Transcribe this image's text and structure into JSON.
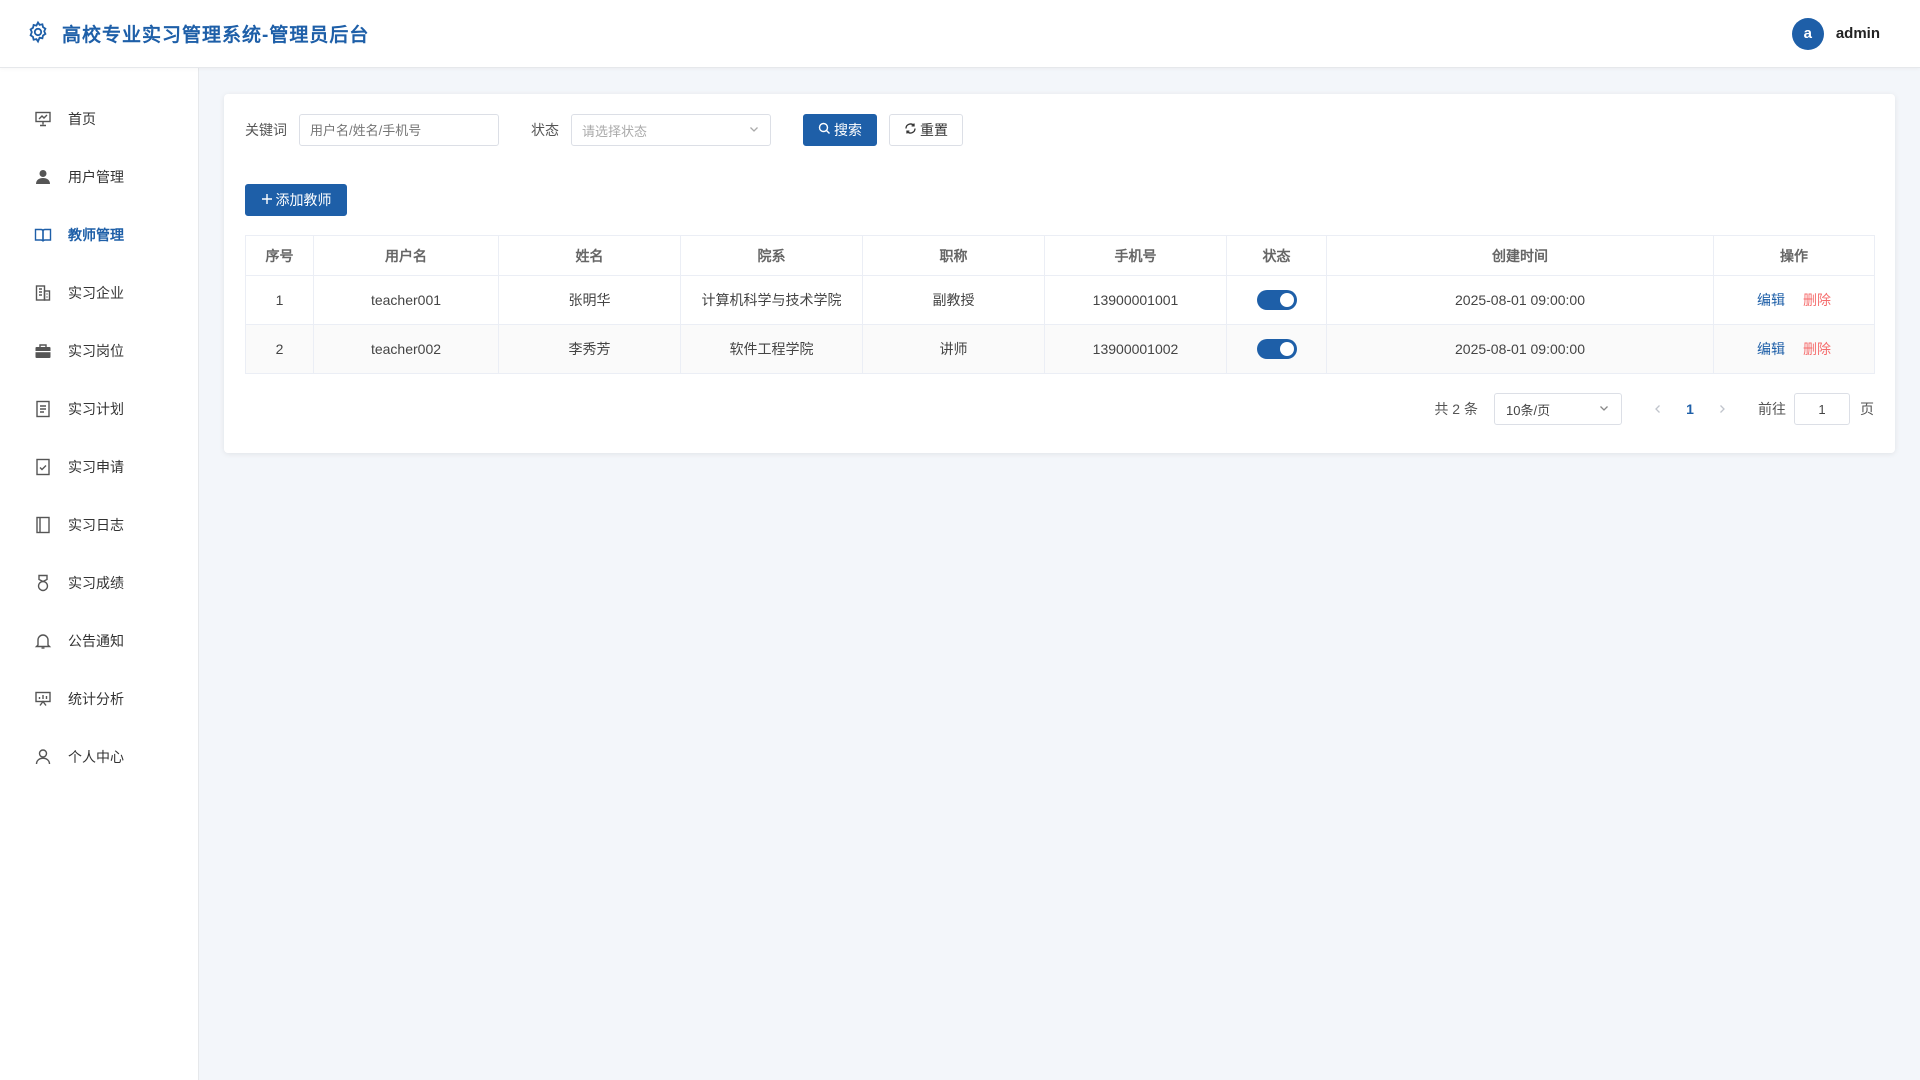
{
  "app": {
    "title": "高校专业实习管理系统-管理员后台",
    "brand_color": "#1e5fa8",
    "icon": "gear-icon"
  },
  "user": {
    "avatar_letter": "a",
    "name": "admin"
  },
  "sidebar": {
    "items": [
      {
        "label": "首页",
        "icon": "presentation-board-icon"
      },
      {
        "label": "用户管理",
        "icon": "user-filled-icon"
      },
      {
        "label": "教师管理",
        "icon": "open-book-icon",
        "active": true
      },
      {
        "label": "实习企业",
        "icon": "building-icon"
      },
      {
        "label": "实习岗位",
        "icon": "briefcase-icon"
      },
      {
        "label": "实习计划",
        "icon": "document-icon"
      },
      {
        "label": "实习申请",
        "icon": "checked-document-icon"
      },
      {
        "label": "实习日志",
        "icon": "notebook-icon"
      },
      {
        "label": "实习成绩",
        "icon": "medal-icon"
      },
      {
        "label": "公告通知",
        "icon": "bell-icon"
      },
      {
        "label": "统计分析",
        "icon": "chart-board-icon"
      },
      {
        "label": "个人中心",
        "icon": "user-outline-icon"
      }
    ]
  },
  "filters": {
    "keyword_label": "关键词",
    "keyword_placeholder": "用户名/姓名/手机号",
    "status_label": "状态",
    "status_placeholder": "请选择状态",
    "search_label": "搜索",
    "reset_label": "重置"
  },
  "actions": {
    "add_label": "添加教师"
  },
  "table": {
    "columns": [
      "序号",
      "用户名",
      "姓名",
      "院系",
      "职称",
      "手机号",
      "状态",
      "创建时间",
      "操作"
    ],
    "rows": [
      {
        "index": "1",
        "username": "teacher001",
        "name": "张明华",
        "dept": "计算机科学与技术学院",
        "title": "副教授",
        "phone": "13900001001",
        "status_on": true,
        "created": "2025-08-01 09:00:00",
        "edit": "编辑",
        "delete": "删除"
      },
      {
        "index": "2",
        "username": "teacher002",
        "name": "李秀芳",
        "dept": "软件工程学院",
        "title": "讲师",
        "phone": "13900001002",
        "status_on": true,
        "created": "2025-08-01 09:00:00",
        "edit": "编辑",
        "delete": "删除"
      }
    ]
  },
  "pagination": {
    "total_text": "共 2 条",
    "page_size": "10条/页",
    "current_page": "1",
    "goto_label": "前往",
    "goto_value": "1",
    "page_suffix": "页"
  }
}
